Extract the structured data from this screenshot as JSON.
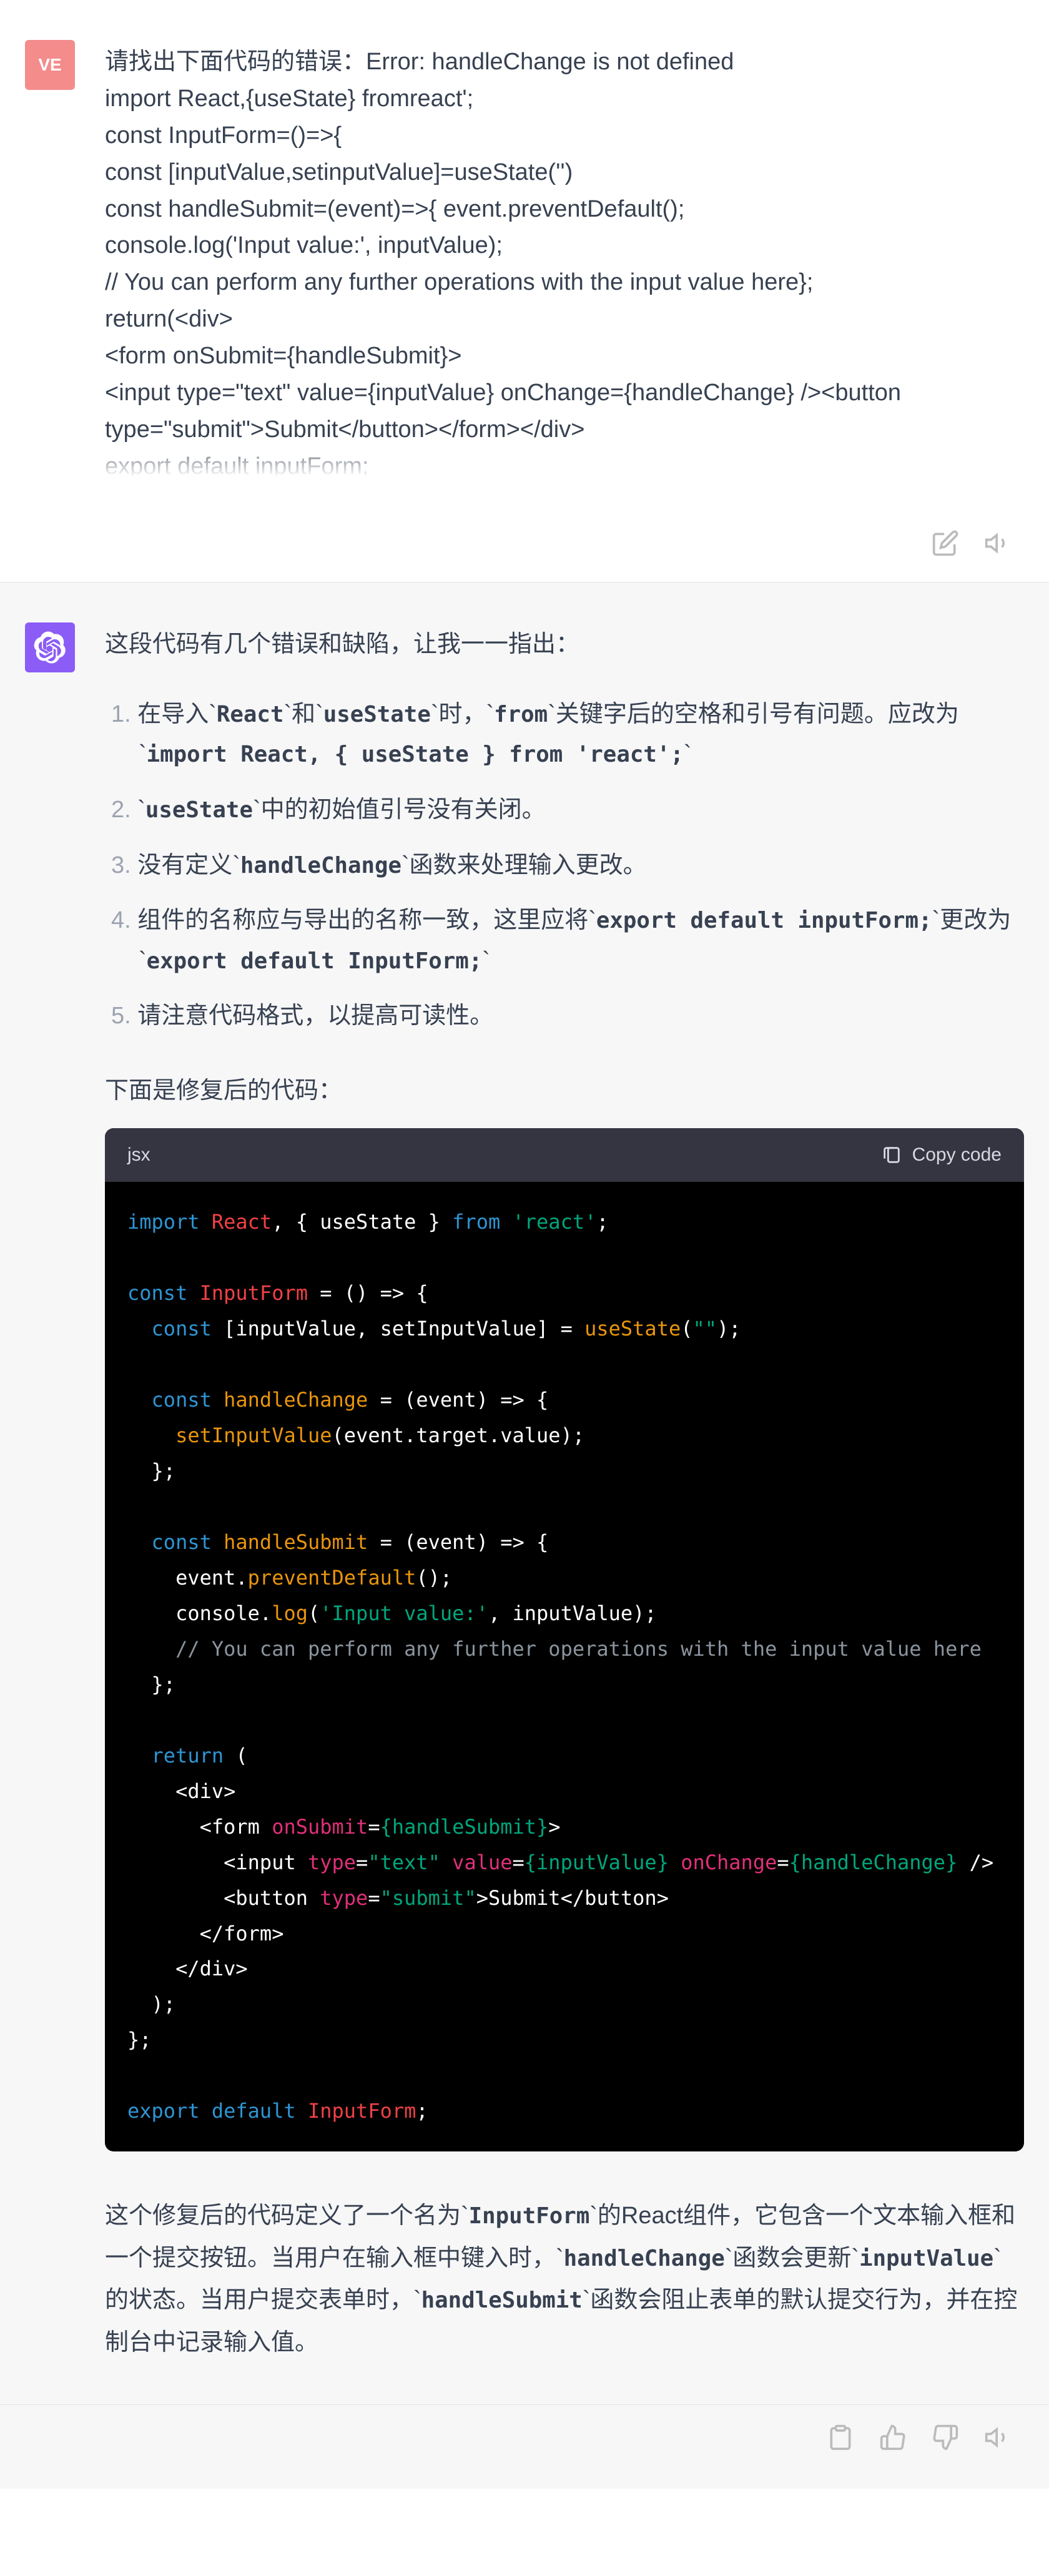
{
  "user": {
    "avatar_label": "VE",
    "text": "请找出下面代码的错误：Error: handleChange is not defined\nimport React,{useState} fromreact';\nconst InputForm=()=>{\nconst [inputValue,setinputValue]=useState('')\nconst handleSubmit=(event)=>{ event.preventDefault();\nconsole.log('Input value:', inputValue);\n// You can perform any further operations with the input value here};\nreturn(<div>\n<form onSubmit={handleSubmit}>\n<input type=\"text\" value={inputValue} onChange={handleChange} /><button type=\"submit\">Submit</button></form></div>\nexport default inputForm;"
  },
  "assistant": {
    "intro": "这段代码有几个错误和缺陷，让我一一指出：",
    "points": {
      "p1_a": "在导入",
      "p1_b": "React",
      "p1_c": "和",
      "p1_d": "useState",
      "p1_e": "时，",
      "p1_f": "from",
      "p1_g": "关键字后的空格和引号有问题。应改为",
      "p1_h": "import React, { useState } from 'react';",
      "p2_a": "useState",
      "p2_b": "中的初始值引号没有关闭。",
      "p3_a": "没有定义",
      "p3_b": "handleChange",
      "p3_c": "函数来处理输入更改。",
      "p4_a": "组件的名称应与导出的名称一致，这里应将",
      "p4_b": "export default inputForm;",
      "p4_c": "更改为",
      "p4_d": "export default InputForm;",
      "p5": "请注意代码格式，以提高可读性。"
    },
    "subhead": "下面是修复后的代码：",
    "code_lang": "jsx",
    "copy_label": "Copy code",
    "code": {
      "l1_import": "import",
      "l1_react": "React",
      "l1_comma": ", { useState } ",
      "l1_from": "from",
      "l1_str": " 'react'",
      "l1_semi": ";",
      "l3_const": "const",
      "l3_name": " InputForm",
      "l3_rest": " = () => {",
      "l4_const": "  const",
      "l4_rest1": " [inputValue, setInputValue] = ",
      "l4_fn": "useState",
      "l4_paren": "(",
      "l4_str": "\"\"",
      "l4_close": ");",
      "l6_const": "  const",
      "l6_fn": " handleChange",
      "l6_rest": " = (event) => {",
      "l7_fn": "    setInputValue",
      "l7_rest": "(event.target.value);",
      "l8": "  };",
      "l10_const": "  const",
      "l10_fn": " handleSubmit",
      "l10_rest": " = (event) => {",
      "l11_a": "    event.",
      "l11_fn": "preventDefault",
      "l11_b": "();",
      "l12_a": "    console.",
      "l12_fn": "log",
      "l12_b": "(",
      "l12_str": "'Input value:'",
      "l12_c": ", inputValue);",
      "l13": "    // You can perform any further operations with the input value here",
      "l14": "  };",
      "l16": "  return",
      "l16b": " (",
      "l17": "    <div>",
      "l18a": "      <form ",
      "l18attr": "onSubmit",
      "l18b": "=",
      "l18val": "{handleSubmit}",
      "l18c": ">",
      "l19a": "        <input ",
      "l19attr1": "type",
      "l19eq1": "=",
      "l19str1": "\"text\"",
      "l19sp1": " ",
      "l19attr2": "value",
      "l19eq2": "=",
      "l19val2": "{inputValue}",
      "l19sp2": " ",
      "l19attr3": "onChange",
      "l19eq3": "=",
      "l19val3": "{handleChange}",
      "l19end": " />",
      "l20a": "        <button ",
      "l20attr": "type",
      "l20eq": "=",
      "l20str": "\"submit\"",
      "l20b": ">Submit</button>",
      "l21": "      </form>",
      "l22": "    </div>",
      "l23": "  );",
      "l24": "};",
      "l26a": "export",
      "l26b": " default",
      "l26c": " InputForm",
      "l26d": ";"
    },
    "explain_a": "这个修复后的代码定义了一个名为",
    "explain_b": "InputForm",
    "explain_c": "的React组件，它包含一个文本输入框和一个提交按钮。当用户在输入框中键入时，",
    "explain_d": "handleChange",
    "explain_e": "函数会更新",
    "explain_f": "inputValue",
    "explain_g": "的状态。当用户提交表单时，",
    "explain_h": "handleSubmit",
    "explain_i": "函数会阻止表单的默认提交行为，并在控制台中记录输入值。"
  }
}
